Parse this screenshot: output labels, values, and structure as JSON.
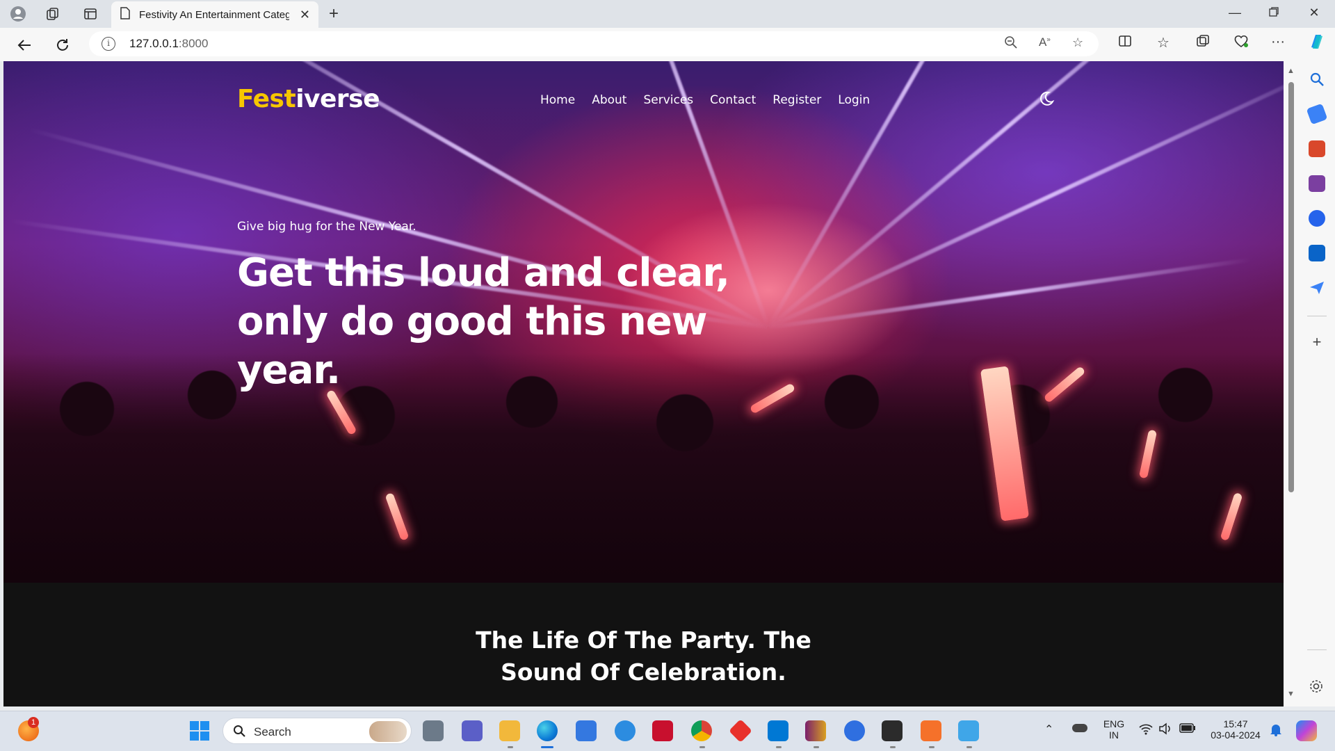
{
  "browser": {
    "tab_title": "Festivity An Entertainment Category",
    "url_host": "127.0.0.1",
    "url_port": ":8000"
  },
  "site": {
    "brand_accent": "Fest",
    "brand_rest": "iverse",
    "nav": [
      "Home",
      "About",
      "Services",
      "Contact",
      "Register",
      "Login"
    ],
    "hero_tagline": "Give big hug for the New Year.",
    "hero_heading": "Get this loud and clear, only do good this new year.",
    "section_heading_line1": "The Life Of The Party. The",
    "section_heading_line2": "Sound Of Celebration."
  },
  "taskbar": {
    "search_placeholder": "Search",
    "notification_count": "1",
    "language_line1": "ENG",
    "language_line2": "IN",
    "time": "15:47",
    "date": "03-04-2024"
  },
  "colors": {
    "brand_accent": "#f7c600",
    "edge_blue": "#1e6fd9"
  }
}
